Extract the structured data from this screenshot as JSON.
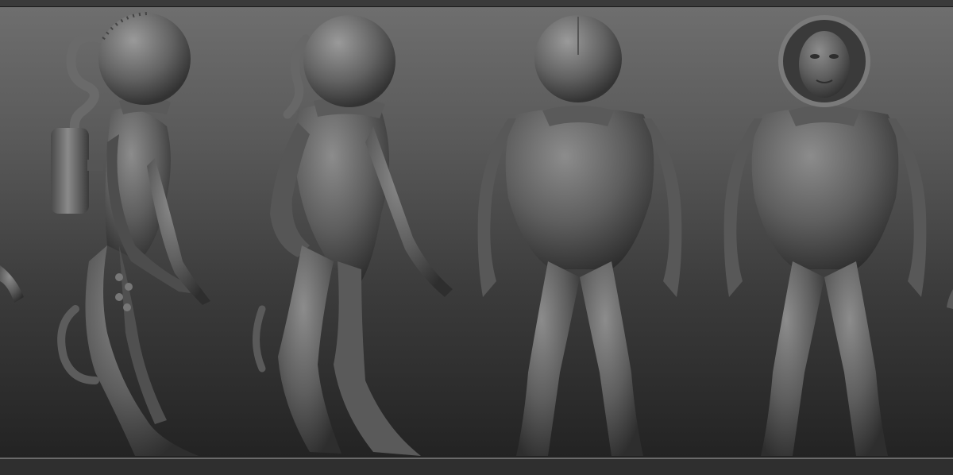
{
  "scene": {
    "background": {
      "top": "#6e6e6e",
      "bottom": "#232323"
    },
    "sculpt_material": "#6a6a6a",
    "figures": [
      {
        "view": "side-profile"
      },
      {
        "view": "three-quarter"
      },
      {
        "view": "front-opaque-helmet"
      },
      {
        "view": "front-clear-helmet"
      }
    ]
  }
}
